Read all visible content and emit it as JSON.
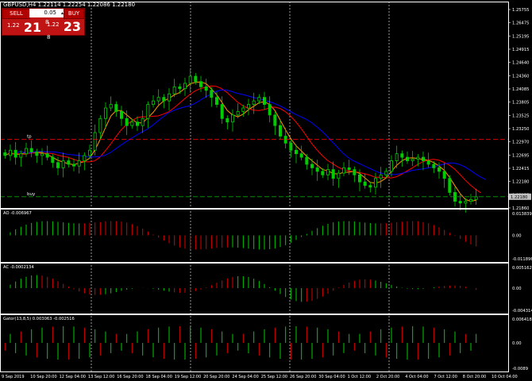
{
  "header": {
    "symbol_line": "GBPUSD,H4  1.22114 1.22254 1.22086 1.22180",
    "ticket": {
      "sell_label": "SELL",
      "buy_label": "BUY",
      "lot": "0.05",
      "sell_prefix": "1.22",
      "sell_big": "21",
      "sell_sup": "8",
      "buy_prefix": "1.22",
      "buy_big": "23",
      "buy_sup": "8"
    }
  },
  "colors": {
    "bull": "#00cc00",
    "bear": "#dd0000",
    "ma_orange": "#ff9900",
    "ma_red": "#ff0000",
    "ma_blue": "#0000ff",
    "line_tp": "#ff0000",
    "line_buy": "#00aa00",
    "grid": "#ffffff",
    "price_tag": "#c0c0c0"
  },
  "chart_data": [
    {
      "type": "line",
      "name": "GBPUSD,H4",
      "ylim": [
        1.2186,
        1.2772
      ],
      "y_ticks": [
        "1.25755",
        "1.26475",
        "1.25195",
        "1.24915",
        "1.24640",
        "1.24360",
        "1.24085",
        "1.23805",
        "1.23525",
        "1.23250",
        "1.22970",
        "1.22695",
        "1.22415",
        "1.22180",
        "1.22135",
        "1.21860"
      ],
      "x_ticks": [
        "9 Sep 2019",
        "10 Sep 20:00",
        "12 Sep 04:00",
        "13 Sep 12:00",
        "16 Sep 20:00",
        "18 Sep 04:00",
        "19 Sep 12:00",
        "20 Sep 20:00",
        "24 Sep 04:00",
        "25 Sep 12:00",
        "26 Sep 20:00",
        "30 Sep 04:00",
        "1 Oct 12:00",
        "2 Oct 20:00",
        "4 Oct 04:00",
        "7 Oct 12:00",
        "8 Oct 20:00",
        "10 Oct 04:00"
      ],
      "closes": [
        1.2335,
        1.235,
        1.233,
        1.234,
        1.2355,
        1.2345,
        1.2335,
        1.234,
        1.233,
        1.2315,
        1.23,
        1.232,
        1.231,
        1.2305,
        1.232,
        1.2335,
        1.235,
        1.24,
        1.244,
        1.247,
        1.248,
        1.246,
        1.244,
        1.242,
        1.243,
        1.242,
        1.244,
        1.248,
        1.249,
        1.25,
        1.249,
        1.251,
        1.253,
        1.2525,
        1.254,
        1.256,
        1.2545,
        1.253,
        1.252,
        1.25,
        1.248,
        1.244,
        1.243,
        1.245,
        1.246,
        1.247,
        1.248,
        1.249,
        1.25,
        1.248,
        1.245,
        1.242,
        1.239,
        1.237,
        1.235,
        1.234,
        1.233,
        1.231,
        1.23,
        1.229,
        1.228,
        1.2295,
        1.227,
        1.2285,
        1.23,
        1.2295,
        1.228,
        1.226,
        1.225,
        1.2245,
        1.227,
        1.228,
        1.229,
        1.232,
        1.234,
        1.233,
        1.232,
        1.2325,
        1.233,
        1.232,
        1.231,
        1.23,
        1.229,
        1.227,
        1.223,
        1.2205,
        1.22,
        1.2205,
        1.221,
        1.2218
      ],
      "series_names": [],
      "hlines": [
        {
          "label": "tp",
          "value": 1.23805
        },
        {
          "label": "buy",
          "value": 1.2218
        }
      ],
      "current_price": "1.22180",
      "grid": true
    },
    {
      "type": "bar",
      "title": "AO -0.006967",
      "ylim": [
        -0.011896,
        0.013839
      ],
      "y_ticks": [
        "0.013839",
        "0.00",
        "-0.011896"
      ]
    },
    {
      "type": "bar",
      "title": "AC -0.0002134",
      "ylim": [
        -0.004314,
        0.005162
      ],
      "y_ticks": [
        "0.0051620",
        "0.00",
        "-0.004314"
      ]
    },
    {
      "type": "bar",
      "title": "Gator(13,8,5) 0.003063 -0.002516",
      "ylim": [
        -0.009,
        0.006418
      ],
      "y_ticks": [
        "0.006418",
        "0.00",
        "-0.0089"
      ]
    }
  ]
}
